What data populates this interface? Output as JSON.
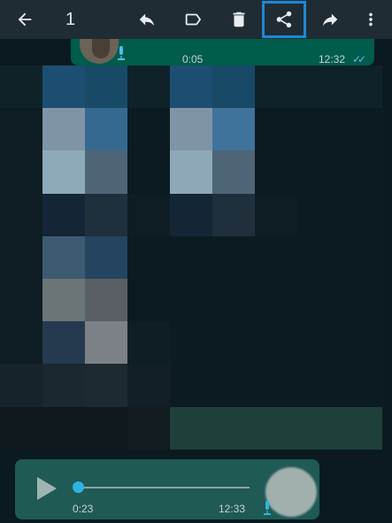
{
  "toolbar": {
    "selected_count": "1",
    "icons": [
      "back-arrow-icon",
      "reply-icon",
      "label-icon",
      "delete-icon",
      "share-icon",
      "forward-icon",
      "more-vert-icon"
    ]
  },
  "messages": [
    {
      "duration": "0:05",
      "time": "12:32",
      "ticks": "✓✓"
    },
    {
      "duration": "0:23",
      "time": "12:33"
    }
  ],
  "colors": {
    "toolbar_bg": "#202c33",
    "bubble_green": "#005c4b",
    "highlight": "#1e88d4",
    "read_tick": "#53bdeb"
  },
  "pixel_image": [
    [
      "#0f2228",
      "#1c4e72",
      "#184a68",
      "#0f2229",
      "#1c4e72",
      "#184a68",
      "#0f2229",
      "#0f2229",
      "#0f2229"
    ],
    [
      "#0d1d23",
      "#7f95a5",
      "#366990",
      "#0c1b21",
      "#7f95a5",
      "#3f739b",
      "#0c1b21",
      "#0c1b21",
      "#0c1b21"
    ],
    [
      "#0d1d23",
      "#8eaab9",
      "#4e6477",
      "#0c1b21",
      "#8ea8b8",
      "#4e6477",
      "#0c1b21",
      "#0c1b21",
      "#0c1b21"
    ],
    [
      "#0d1d23",
      "#142536",
      "#1f2f3c",
      "#0d1d23",
      "#142536",
      "#1f2f3c",
      "#0e1d23",
      "#0c1b21",
      "#0c1b21"
    ],
    [
      "#0d1d23",
      "#3c5a72",
      "#244460",
      "#0c1b21",
      "#0c1b21",
      "#0c1b21",
      "#0c1b21",
      "#0c1b21",
      "#0c1b21"
    ],
    [
      "#0d1d23",
      "#6b7577",
      "#595f64",
      "#0c1b21",
      "#0c1b21",
      "#0c1b21",
      "#0c1b21",
      "#0c1b21",
      "#0c1b21"
    ],
    [
      "#0d1d23",
      "#253a4f",
      "#7b8186",
      "#0f1e24",
      "#0c1b21",
      "#0c1b21",
      "#0c1b21",
      "#0c1b21",
      "#0c1b21"
    ],
    [
      "#17232a",
      "#1b282f",
      "#1d2a31",
      "#121f26",
      "#0c1b21",
      "#0c1b21",
      "#0c1b21",
      "#0c1b21",
      "#0c1b21"
    ],
    [
      "#10191e",
      "#10191e",
      "#10191e",
      "#111b20",
      "#1e3f3a",
      "#1e3f3a",
      "#1e3f3a",
      "#1e3f3a",
      "#1e3f3a"
    ]
  ]
}
